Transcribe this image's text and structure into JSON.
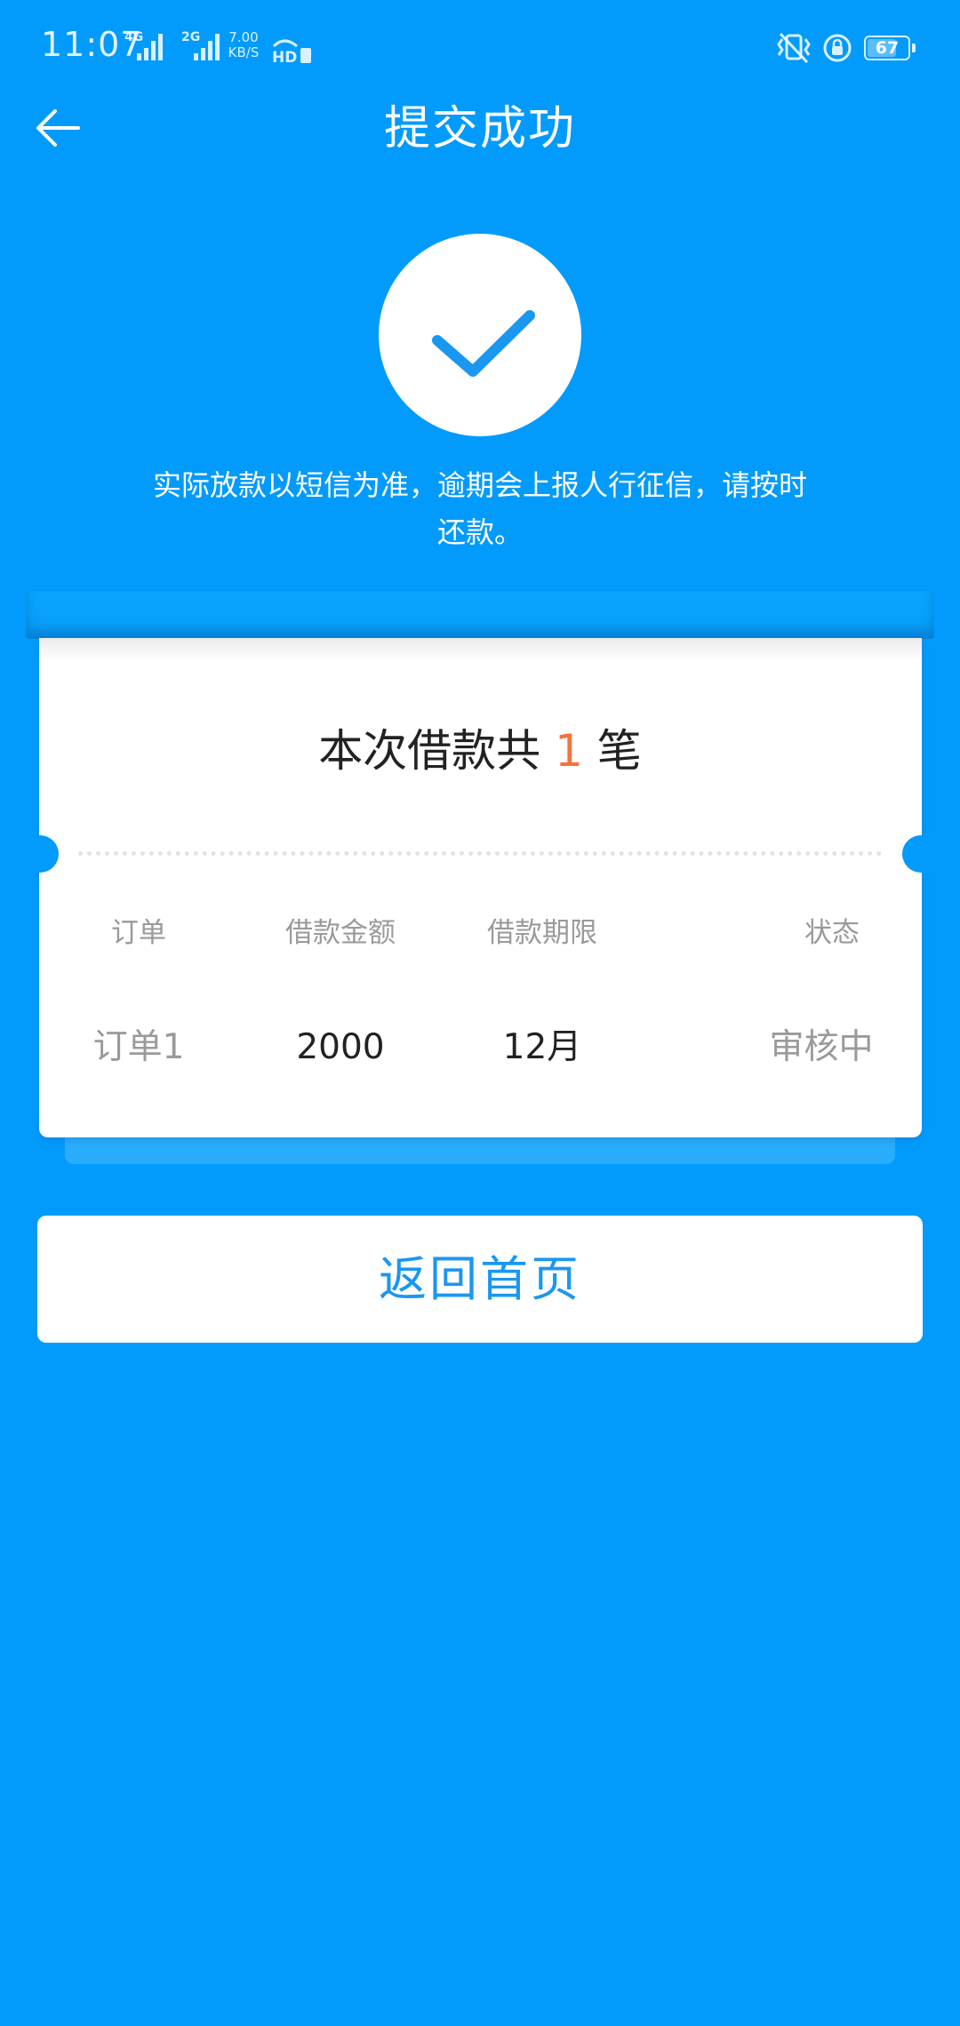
{
  "status_bar": {
    "time": "11:07",
    "sim1_label": "4G",
    "sim2_label": "2G",
    "net_speed_value": "7.00",
    "net_speed_unit": "KB/S",
    "hd_label": "HD",
    "battery_level": "67",
    "icons": [
      "signal-icon",
      "signal-icon",
      "hd-voice-icon",
      "vibrate-icon",
      "rotation-lock-icon",
      "battery-icon"
    ]
  },
  "header": {
    "title": "提交成功",
    "back_icon": "arrow-left-icon"
  },
  "success": {
    "icon": "checkmark-icon",
    "notice": "实际放款以短信为准，逾期会上报人行征信，请按时还款。"
  },
  "summary": {
    "prefix": "本次借款共 ",
    "count": "1",
    "suffix": " 笔"
  },
  "table": {
    "headers": [
      "订单",
      "借款金额",
      "借款期限",
      "状态"
    ],
    "rows": [
      [
        "订单1",
        "2000",
        "12月",
        "审核中"
      ]
    ]
  },
  "actions": {
    "home_label": "返回首页"
  },
  "colors": {
    "background": "#039BFB",
    "accent": "#1A97F0",
    "highlight": "#F2743E"
  }
}
